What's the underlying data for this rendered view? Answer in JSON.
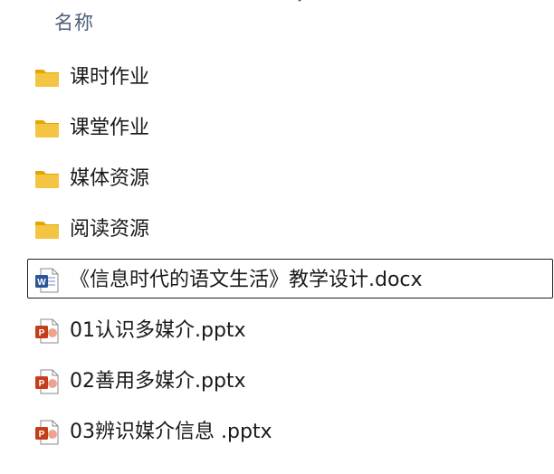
{
  "header": {
    "name_column_label": "名称"
  },
  "colors": {
    "folder": "#f4c542",
    "word": "#2b579a",
    "powerpoint": "#c43e1c"
  },
  "files": [
    {
      "name": "课时作业",
      "type": "folder",
      "icon": "folder-icon",
      "selected": false
    },
    {
      "name": "课堂作业",
      "type": "folder",
      "icon": "folder-icon",
      "selected": false
    },
    {
      "name": "媒体资源",
      "type": "folder",
      "icon": "folder-icon",
      "selected": false
    },
    {
      "name": "阅读资源",
      "type": "folder",
      "icon": "folder-icon",
      "selected": false
    },
    {
      "name": "《信息时代的语文生活》教学设计.docx",
      "type": "docx",
      "icon": "word-doc-icon",
      "selected": true
    },
    {
      "name": "01认识多媒介.pptx",
      "type": "pptx",
      "icon": "powerpoint-icon",
      "selected": false
    },
    {
      "name": "02善用多媒介.pptx",
      "type": "pptx",
      "icon": "powerpoint-icon",
      "selected": false
    },
    {
      "name": "03辨识媒介信息 .pptx",
      "type": "pptx",
      "icon": "powerpoint-icon",
      "selected": false
    }
  ]
}
